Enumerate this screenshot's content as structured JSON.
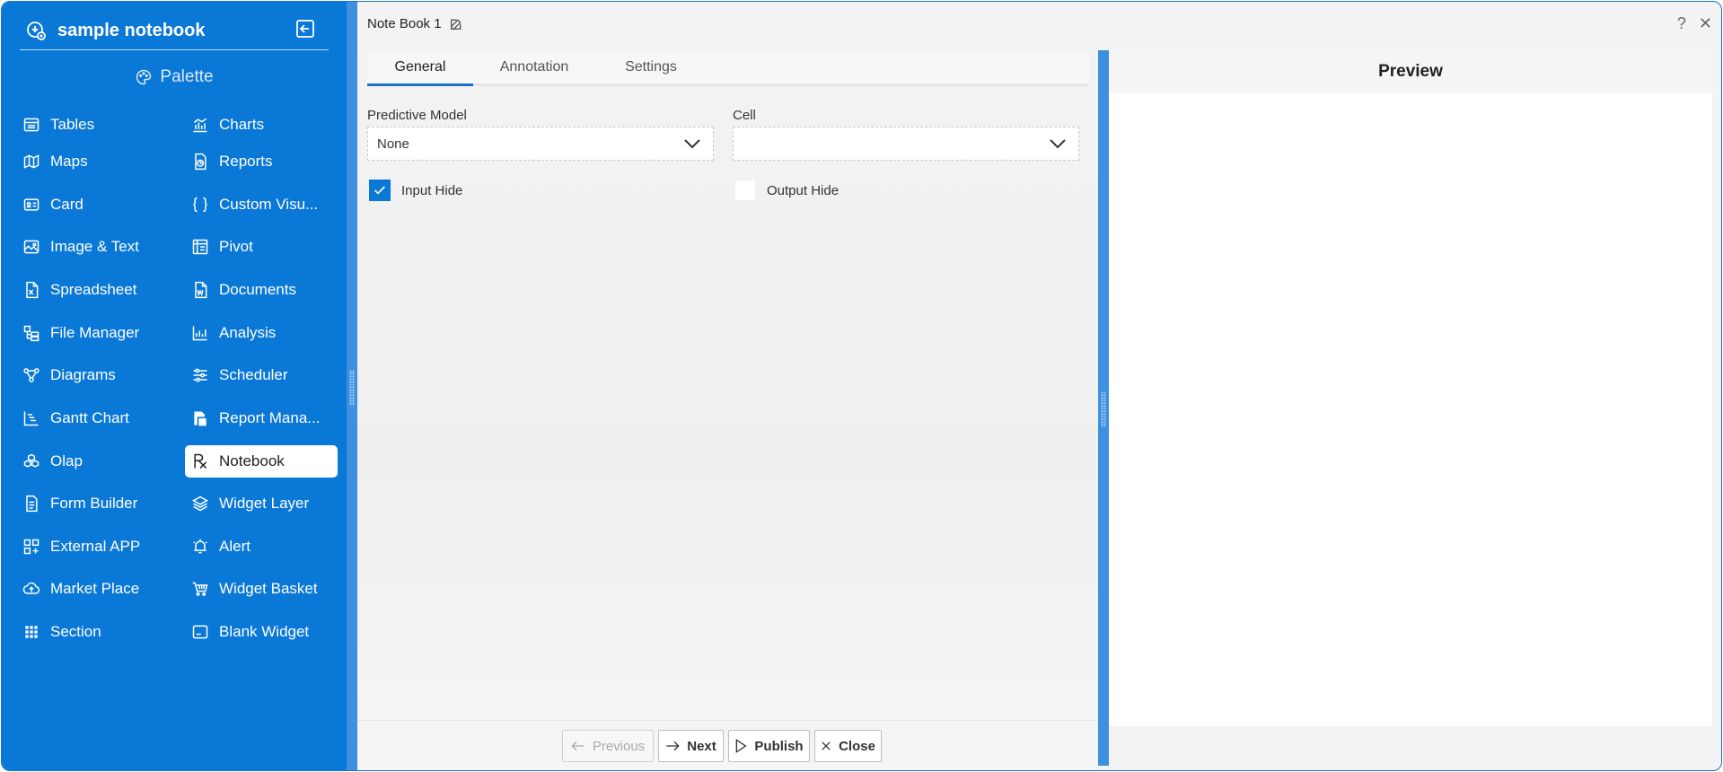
{
  "app": {
    "title": "sample notebook"
  },
  "palette": {
    "label": "Palette"
  },
  "sidebar": {
    "left": [
      {
        "label": "Tables",
        "icon": "table-icon"
      },
      {
        "label": "Maps",
        "icon": "map-icon"
      },
      {
        "label": "Card",
        "icon": "card-icon"
      },
      {
        "label": "Image & Text",
        "icon": "image-icon"
      },
      {
        "label": "Spreadsheet",
        "icon": "spreadsheet-icon"
      },
      {
        "label": "File Manager",
        "icon": "file-manager-icon"
      },
      {
        "label": "Diagrams",
        "icon": "diagram-icon"
      },
      {
        "label": "Gantt Chart",
        "icon": "gantt-icon"
      },
      {
        "label": "Olap",
        "icon": "olap-icon"
      },
      {
        "label": "Form Builder",
        "icon": "form-icon"
      },
      {
        "label": "External APP",
        "icon": "external-app-icon"
      },
      {
        "label": "Market Place",
        "icon": "cloud-upload-icon"
      },
      {
        "label": "Section",
        "icon": "grid-icon"
      }
    ],
    "right": [
      {
        "label": "Charts",
        "icon": "chart-icon"
      },
      {
        "label": "Reports",
        "icon": "report-icon"
      },
      {
        "label": "Custom Visu...",
        "icon": "braces-icon"
      },
      {
        "label": "Pivot",
        "icon": "pivot-icon"
      },
      {
        "label": "Documents",
        "icon": "word-doc-icon"
      },
      {
        "label": "Analysis",
        "icon": "analysis-icon"
      },
      {
        "label": "Scheduler",
        "icon": "sliders-icon"
      },
      {
        "label": "Report Mana...",
        "icon": "report-manager-icon"
      },
      {
        "label": "Notebook",
        "icon": "rx-icon",
        "active": true
      },
      {
        "label": "Widget Layer",
        "icon": "layers-icon"
      },
      {
        "label": "Alert",
        "icon": "alert-icon"
      },
      {
        "label": "Widget Basket",
        "icon": "basket-icon"
      },
      {
        "label": "Blank Widget",
        "icon": "blank-widget-icon"
      }
    ]
  },
  "notebook": {
    "title": "Note Book 1",
    "tabs": [
      {
        "label": "General",
        "active": true
      },
      {
        "label": "Annotation"
      },
      {
        "label": "Settings"
      }
    ],
    "predictive_model": {
      "label": "Predictive Model",
      "value": "None"
    },
    "cell": {
      "label": "Cell",
      "value": ""
    },
    "input_hide": {
      "label": "Input Hide",
      "checked": true
    },
    "output_hide": {
      "label": "Output Hide",
      "checked": false
    }
  },
  "footer": {
    "previous": "Previous",
    "next": "Next",
    "publish": "Publish",
    "close": "Close"
  },
  "preview": {
    "title": "Preview"
  },
  "window": {
    "help": "?",
    "close": "✕"
  },
  "colors": {
    "accent": "#0a78d7",
    "splitter": "#3d8fe0"
  }
}
